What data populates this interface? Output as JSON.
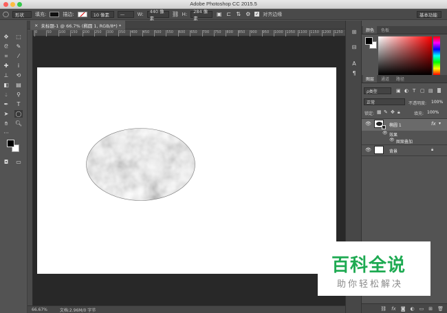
{
  "window": {
    "title": "Adobe Photoshop CC 2015.5"
  },
  "options_bar": {
    "mode_value": "形状",
    "fill_label": "填充:",
    "stroke_label": "描边:",
    "stroke_size": "10 像素",
    "w_label": "W:",
    "w_value": "440 像素",
    "link_icon": "link-icon",
    "h_label": "H:",
    "h_value": "284 像素",
    "align_edges_label": "对齐边缘",
    "workspace": "基本功能",
    "fill_color": "#111111"
  },
  "document": {
    "tab_title": "未标题-1 @ 66.7% (椭圆 1, RGB/8*) *",
    "ruler_ticks": [
      "0",
      "50",
      "100",
      "150",
      "200",
      "250",
      "300",
      "350",
      "400",
      "450",
      "500",
      "550",
      "600",
      "650",
      "700",
      "750",
      "800",
      "850",
      "900",
      "950",
      "1000",
      "1050",
      "1100",
      "1150",
      "1200",
      "1250"
    ]
  },
  "status": {
    "zoom": "66.67%",
    "doc_info": "文档:2.96M/0 字节"
  },
  "color_panel": {
    "tabs": [
      "颜色",
      "色板"
    ]
  },
  "layers_panel": {
    "tabs": [
      "图层",
      "通道",
      "路径"
    ],
    "filter_kind": "ρ类型",
    "blend_mode": "正常",
    "opacity_label": "不透明度:",
    "opacity_value": "100%",
    "lock_label": "锁定:",
    "fill_label": "填充:",
    "fill_value": "100%",
    "layers": [
      {
        "name": "椭圆 1",
        "fx": "fx",
        "effects_label": "效果",
        "effect": "图案叠加"
      },
      {
        "name": "背景"
      }
    ]
  },
  "watermark": {
    "logo": "百科全说",
    "subtitle": "助你轻松解决"
  }
}
